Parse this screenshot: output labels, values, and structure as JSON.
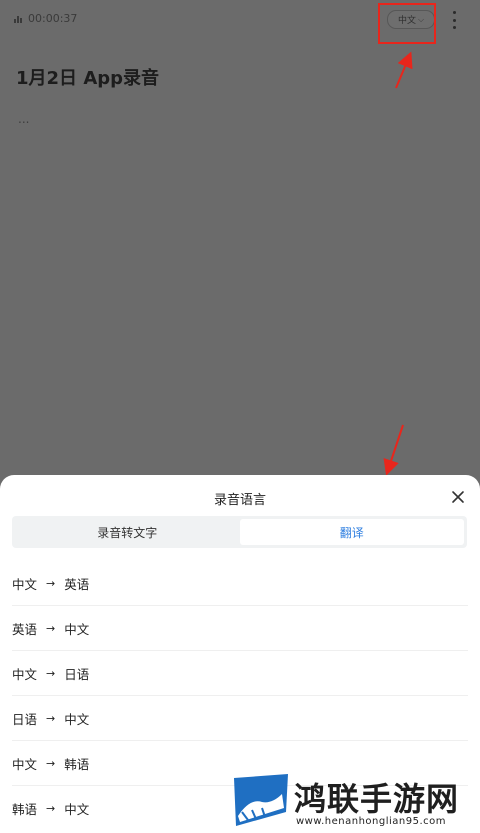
{
  "topbar": {
    "timer": "00:00:37",
    "language_chip": "中文"
  },
  "document": {
    "title": "1月2日 App录音",
    "preview": "..."
  },
  "sheet": {
    "title": "录音语言",
    "tabs": [
      {
        "label": "录音转文字",
        "active": false
      },
      {
        "label": "翻译",
        "active": true
      }
    ],
    "options": [
      {
        "from": "中文",
        "to": "英语"
      },
      {
        "from": "英语",
        "to": "中文"
      },
      {
        "from": "中文",
        "to": "日语"
      },
      {
        "from": "日语",
        "to": "中文"
      },
      {
        "from": "中文",
        "to": "韩语"
      },
      {
        "from": "韩语",
        "to": "中文"
      }
    ],
    "arrow_glyph": "→"
  },
  "watermark": {
    "name": "鸿联手游网",
    "url": "www.henanhonglian95.com"
  },
  "colors": {
    "accent": "#2f7fe0",
    "annotation_red": "#e8261c",
    "overlay": "#6b6b6b"
  },
  "icons": {
    "close": "close-icon",
    "more": "more-vertical-icon",
    "chevron": "chevron-down-icon",
    "recording": "recording-bars-icon"
  }
}
